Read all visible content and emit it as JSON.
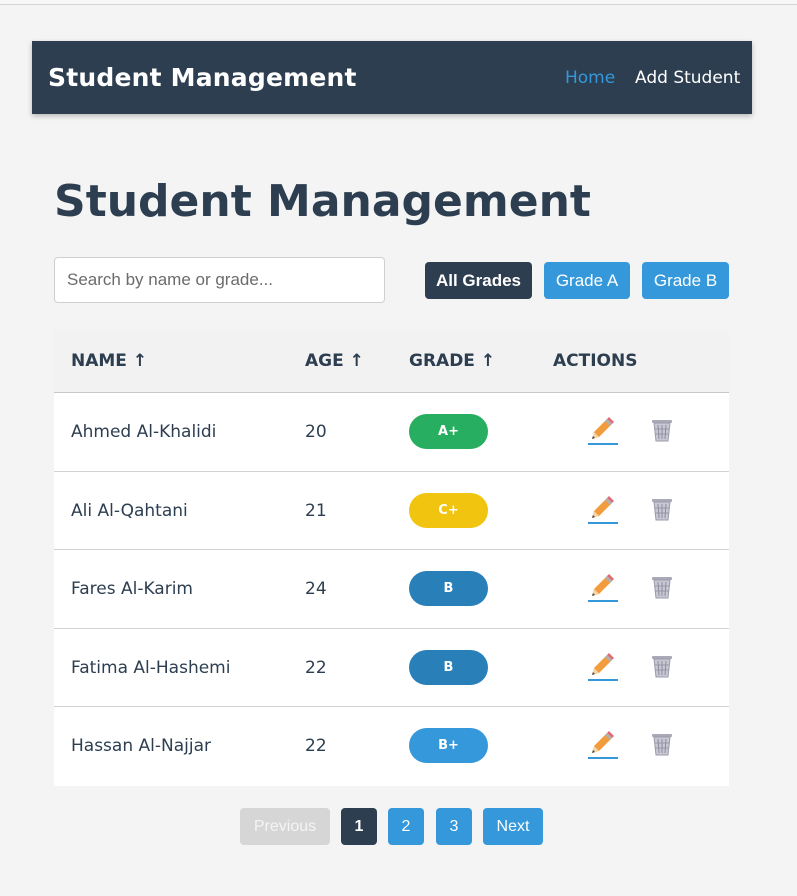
{
  "navbar": {
    "brand": "Student Management",
    "links": [
      {
        "label": "Home",
        "active": true
      },
      {
        "label": "Add Student",
        "active": false
      }
    ]
  },
  "page": {
    "title": "Student Management"
  },
  "search": {
    "placeholder": "Search by name or grade...",
    "value": ""
  },
  "filters": {
    "all": "All Grades",
    "a": "Grade A",
    "b": "Grade B",
    "selected": "All Grades"
  },
  "table": {
    "headers": {
      "name": "NAME ↑",
      "age": "AGE ↑",
      "grade": "GRADE ↑",
      "actions": "ACTIONS"
    },
    "rows": [
      {
        "name": "Ahmed Al-Khalidi",
        "age": "20",
        "grade": "A+",
        "grade_color": "#27ae60"
      },
      {
        "name": "Ali Al-Qahtani",
        "age": "21",
        "grade": "C+",
        "grade_color": "#f1c40f"
      },
      {
        "name": "Fares Al-Karim",
        "age": "24",
        "grade": "B",
        "grade_color": "#2980b9"
      },
      {
        "name": "Fatima Al-Hashemi",
        "age": "22",
        "grade": "B",
        "grade_color": "#2980b9"
      },
      {
        "name": "Hassan Al-Najjar",
        "age": "22",
        "grade": "B+",
        "grade_color": "#3498db"
      }
    ],
    "action_icons": [
      "pencil-icon",
      "wastebasket-icon"
    ]
  },
  "pagination": {
    "previous": "Previous",
    "pages": [
      "1",
      "2",
      "3"
    ],
    "current": "1",
    "next": "Next"
  },
  "colors": {
    "primary": "#2c3e50",
    "accent": "#3498db",
    "background": "#f4f4f4"
  }
}
